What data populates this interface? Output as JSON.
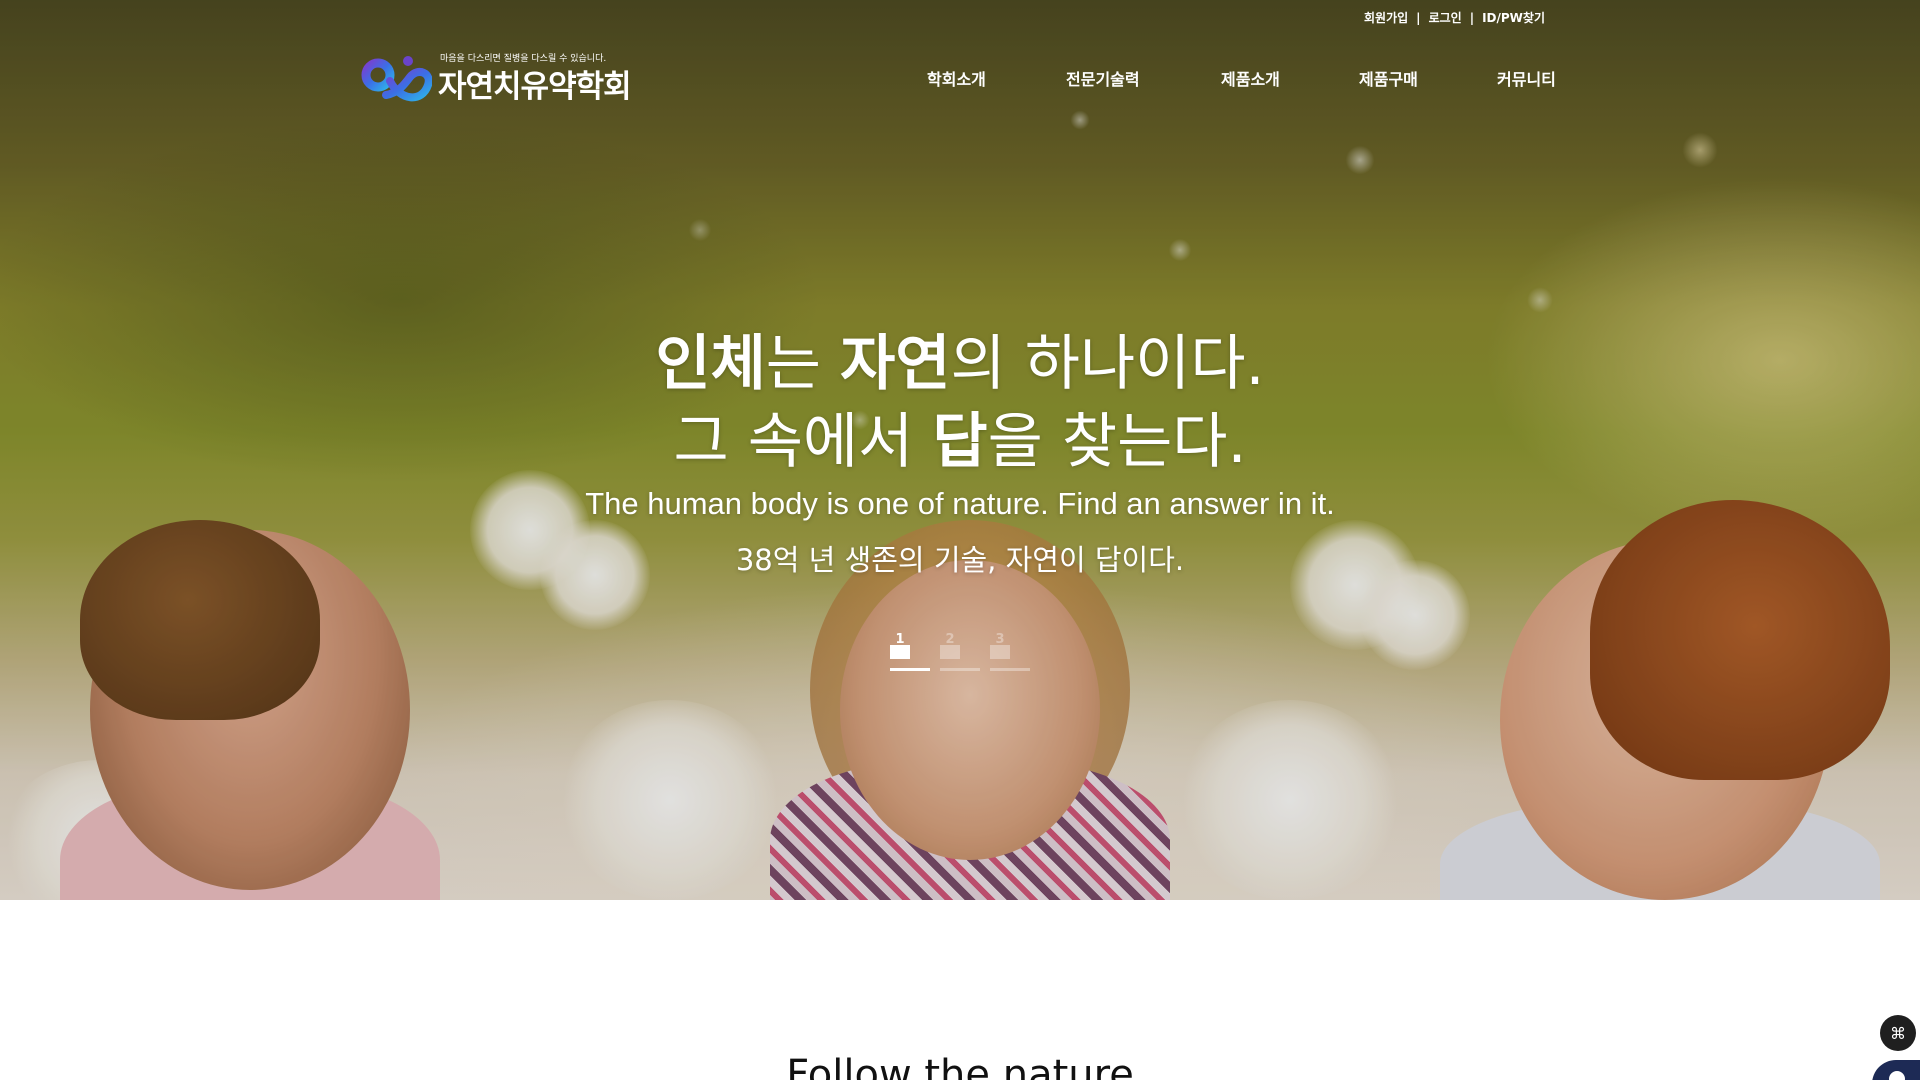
{
  "header": {
    "util_links": [
      "회원가입",
      "로그인",
      "ID/PW찾기"
    ],
    "separator": "|",
    "logo": {
      "tagline": "마음을 다스리면 질병을 다스릴 수 있습니다.",
      "name": "자연치유약학회"
    },
    "nav": [
      "학회소개",
      "전문기술력",
      "제품소개",
      "제품구매",
      "커뮤니티"
    ]
  },
  "hero": {
    "line1": {
      "part1": "인체",
      "part2": "는 ",
      "part3": "자연",
      "part4": "의 하나이다."
    },
    "line2": {
      "part1": "그 속에서 ",
      "part2": "답",
      "part3": "을 찾는다."
    },
    "subtitle_en": "The human body is one of nature. Find an answer in it.",
    "subtitle_ko": "38억 년 생존의 기술, 자연이 답이다.",
    "pager": [
      "1",
      "2",
      "3"
    ],
    "active_slide": 1
  },
  "section": {
    "title": "Follow the nature"
  },
  "colors": {
    "nav_text": "#ffffff",
    "logo_purple": "#5b3fb0",
    "logo_blue": "#2f6fe0",
    "float_button": "#1f1f1f"
  },
  "icons": {
    "float_menu": "command-icon",
    "chatbot": "chatbot-icon"
  }
}
